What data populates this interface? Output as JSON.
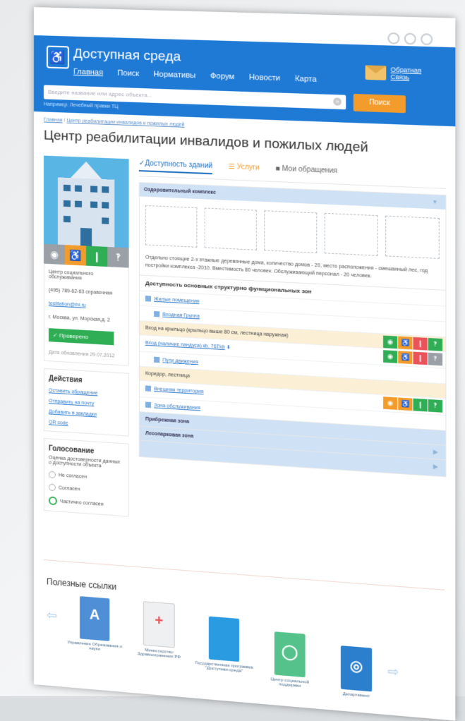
{
  "header": {
    "site_title": "Доступная среда",
    "nav": [
      "Главная",
      "Поиск",
      "Нормативы",
      "Форум",
      "Новости",
      "Карта"
    ],
    "feedback": "Обратная Связь",
    "search_placeholder": "Введите название или адрес объекта...",
    "search_button": "Поиск",
    "hint": "Например: Лечебный правки ТЦ"
  },
  "breadcrumb": {
    "home": "Главная",
    "sep": " / ",
    "current": "Центр реабилитации инвалидов и пожилых людей"
  },
  "page_title": "Центр реабилитации инвалидов и пожилых людей",
  "left": {
    "org_type": "Центр социального обслуживания",
    "phone": "(495) 789-62-63 справочная",
    "email": "testitation@mi.ru",
    "address": "г. Москва, ул. Морская,д. 2",
    "verified": "Проверено",
    "updated": "Дата обновления 29.07.2012",
    "actions_title": "Действия",
    "actions": [
      "Оставить обращение",
      "Отправить на почту",
      "Добавить в закладки",
      "QR code"
    ],
    "vote_title": "Голосование",
    "vote_question": "Оценка достоверности данных о доступности объекта",
    "vote_options": [
      "Не согласен",
      "Согласен",
      "Частично согласен"
    ]
  },
  "tabs": [
    "Доступность зданий",
    "Услуги",
    "Мои обращения"
  ],
  "panel": {
    "header": "Оздоровительный комплекс",
    "description": "Отдельно стоящие 2-х этажные деревянные дома, количество домов - 20, место расположения - смешанный лес, год постройки комплекса -2010. Вместимость 80 человек. Обслуживающий персонал - 20 человек.",
    "section_title": "Доступность основных структурно функциональных зон",
    "rows": {
      "living": "Жилые помещения",
      "entrance": "Входная Группа",
      "porch": "Вход на крыльцо (крыльцо выше 80 см, лестница наружная)",
      "ramp": "Вход (наличие пандуса) кb. 76Тkb",
      "paths": "Пути движения",
      "corridor": "Коридор, лестница",
      "outer": "Внешняя территория",
      "service": "Зона обслуживания"
    },
    "zones": [
      "Прибрежная зона",
      "Лесопарковая зона"
    ]
  },
  "useful": {
    "title": "Полезные ссылки",
    "items": [
      "Управление Образования и науки",
      "Министерство Здравоохранения РФ",
      "Государственная программа \"Доступная среда\"",
      "Центр социальной поддержки",
      "Департамент"
    ]
  },
  "colors": {
    "brand": "#1f7ad6",
    "accent": "#f39c2b",
    "green": "#2fae55",
    "red": "#e8545a",
    "gray": "#9aa0a6"
  }
}
